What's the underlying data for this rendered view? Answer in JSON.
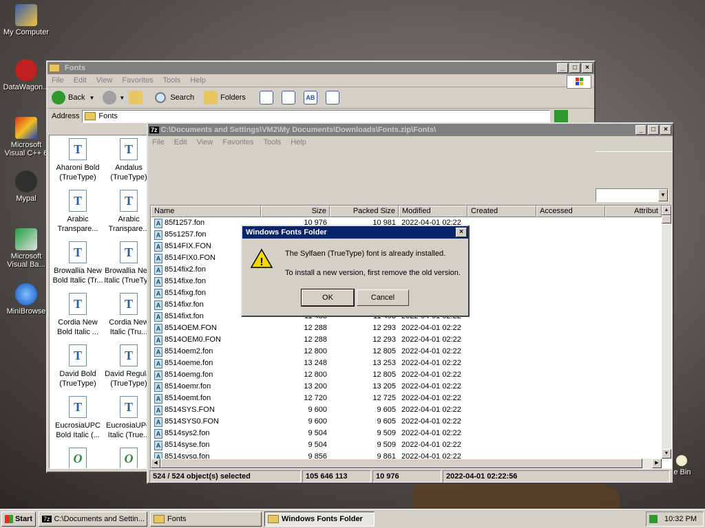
{
  "desktop_icons": [
    {
      "label": "My Computer",
      "icon": "computer-icon"
    },
    {
      "label": "DataWagon...",
      "icon": "shortcut-icon"
    },
    {
      "label": "Microsoft Visual C++ 6",
      "icon": "visual-cpp-icon"
    },
    {
      "label": "Mypal",
      "icon": "mypal-icon"
    },
    {
      "label": "Microsoft Visual Ba...",
      "icon": "visual-basic-icon"
    },
    {
      "label": "MiniBrowse",
      "icon": "minibrowse-icon"
    },
    {
      "label": "e Bin",
      "icon": "recycle-bin-icon"
    }
  ],
  "fonts_window": {
    "title": "Fonts",
    "menu": [
      "File",
      "Edit",
      "View",
      "Favorites",
      "Tools",
      "Help"
    ],
    "toolbar": {
      "back": "Back",
      "search": "Search",
      "folders": "Folders"
    },
    "address_label": "Address",
    "address_value": "Fonts",
    "fonts": [
      {
        "name": "Aharoni Bold (TrueType)",
        "glyph": "T"
      },
      {
        "name": "Andalus (TrueType)",
        "glyph": "T"
      },
      {
        "name": "Arabic Transpare...",
        "glyph": "T"
      },
      {
        "name": "Arabic Transpare...",
        "glyph": "T"
      },
      {
        "name": "Browallia New Bold Italic (Tr...",
        "glyph": "T"
      },
      {
        "name": "Browallia New Italic (TrueTy...",
        "glyph": "T"
      },
      {
        "name": "Cordia New Bold Italic ...",
        "glyph": "T"
      },
      {
        "name": "Cordia New Italic (Tru...",
        "glyph": "T"
      },
      {
        "name": "David Bold (TrueType)",
        "glyph": "T"
      },
      {
        "name": "David Regular (TrueType)",
        "glyph": "T"
      },
      {
        "name": "EucrosiaUPC Bold Italic (...",
        "glyph": "T"
      },
      {
        "name": "EucrosiaUPC Italic (True...",
        "glyph": "T"
      },
      {
        "name": "",
        "glyph": "O"
      },
      {
        "name": "",
        "glyph": "O"
      }
    ]
  },
  "zip_window": {
    "title": "C:\\Documents and Settings\\VM2\\My Documents\\Downloads\\Fonts.zip\\Fonts\\",
    "menu": [
      "File",
      "Edit",
      "View",
      "Favorites",
      "Tools",
      "Help"
    ],
    "columns": [
      "Name",
      "Size",
      "Packed Size",
      "Modified",
      "Created",
      "Accessed",
      "Attribut"
    ],
    "rows": [
      {
        "name": "85f1257.fon",
        "size": "10 976",
        "packed": "10 981",
        "modified": "2022-04-01 02:22"
      },
      {
        "name": "85s1257.fon",
        "size": "",
        "packed": "",
        "modified": ""
      },
      {
        "name": "8514FIX.FON",
        "size": "",
        "packed": "",
        "modified": ""
      },
      {
        "name": "8514FIX0.FON",
        "size": "",
        "packed": "",
        "modified": ""
      },
      {
        "name": "8514fix2.fon",
        "size": "",
        "packed": "",
        "modified": ""
      },
      {
        "name": "8514fixe.fon",
        "size": "",
        "packed": "",
        "modified": ""
      },
      {
        "name": "8514fixg.fon",
        "size": "",
        "packed": "",
        "modified": ""
      },
      {
        "name": "8514fixr.fon",
        "size": "",
        "packed": "",
        "modified": ""
      },
      {
        "name": "8514fixt.fon",
        "size": "11 488",
        "packed": "11 493",
        "modified": "2022-04-01 02:22"
      },
      {
        "name": "8514OEM.FON",
        "size": "12 288",
        "packed": "12 293",
        "modified": "2022-04-01 02:22"
      },
      {
        "name": "8514OEM0.FON",
        "size": "12 288",
        "packed": "12 293",
        "modified": "2022-04-01 02:22"
      },
      {
        "name": "8514oem2.fon",
        "size": "12 800",
        "packed": "12 805",
        "modified": "2022-04-01 02:22"
      },
      {
        "name": "8514oeme.fon",
        "size": "13 248",
        "packed": "13 253",
        "modified": "2022-04-01 02:22"
      },
      {
        "name": "8514oemg.fon",
        "size": "12 800",
        "packed": "12 805",
        "modified": "2022-04-01 02:22"
      },
      {
        "name": "8514oemr.fon",
        "size": "13 200",
        "packed": "13 205",
        "modified": "2022-04-01 02:22"
      },
      {
        "name": "8514oemt.fon",
        "size": "12 720",
        "packed": "12 725",
        "modified": "2022-04-01 02:22"
      },
      {
        "name": "8514SYS.FON",
        "size": "9 600",
        "packed": "9 605",
        "modified": "2022-04-01 02:22"
      },
      {
        "name": "8514SYS0.FON",
        "size": "9 600",
        "packed": "9 605",
        "modified": "2022-04-01 02:22"
      },
      {
        "name": "8514sys2.fon",
        "size": "9 504",
        "packed": "9 509",
        "modified": "2022-04-01 02:22"
      },
      {
        "name": "8514syse.fon",
        "size": "9 504",
        "packed": "9 509",
        "modified": "2022-04-01 02:22"
      },
      {
        "name": "8514sysg.fon",
        "size": "9 856",
        "packed": "9 861",
        "modified": "2022-04-01 02:22"
      }
    ],
    "status": {
      "selected": "524 / 524 object(s) selected",
      "total_size": "105 646 113",
      "item_size": "10 976",
      "modified": "2022-04-01 02:22:56"
    }
  },
  "dialog": {
    "title": "Windows Fonts Folder",
    "message": "The Sylfaen (TrueType) font is already installed.",
    "detail": "To install a new version, first remove the old version.",
    "ok_label": "OK",
    "cancel_label": "Cancel"
  },
  "taskbar": {
    "start_label": "Start",
    "tasks": [
      {
        "label": "C:\\Documents and Settin...",
        "icon": "7zip-icon"
      },
      {
        "label": "Fonts",
        "icon": "folder-icon"
      },
      {
        "label": "Windows Fonts Folder",
        "icon": "folder-icon"
      }
    ],
    "clock": "10:32 PM"
  },
  "colors": {
    "active_title": "#0a246a",
    "inactive_title": "#808080",
    "window_face": "#d4d0c8",
    "selection": "#316ac5"
  }
}
